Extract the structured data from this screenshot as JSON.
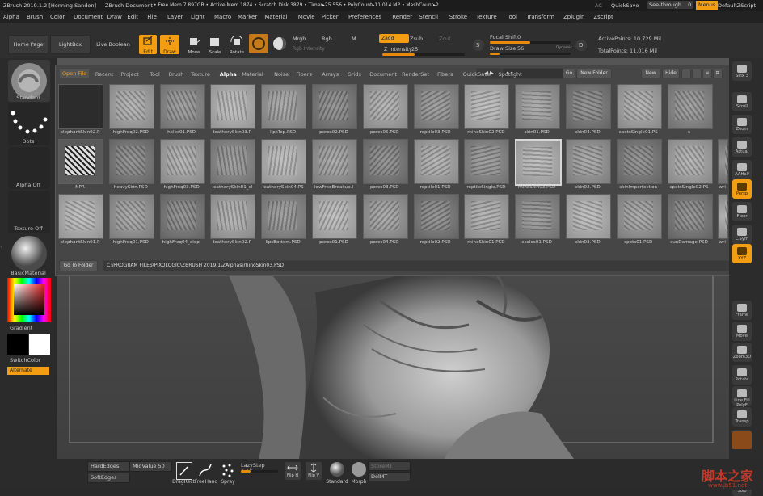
{
  "titlebar": {
    "app": "ZBrush 2019.1.2 [Henning Sanden]",
    "doc": "ZBrush Document",
    "stats": "• Free Mem 7.897GB • Active Mem 1874 • Scratch Disk 3879 • Timer▸25.556 • PolyCount▸11.014 MP • MeshCount▸2",
    "ac": "AC",
    "quicksave": "QuickSave",
    "seethrough": "See-through",
    "seethrough_value": "0",
    "menus": "Menus",
    "script": "DefaultZScript"
  },
  "menubar": [
    "Alpha",
    "Brush",
    "Color",
    "Document",
    "Draw",
    "Edit",
    "File",
    "Layer",
    "Light",
    "Macro",
    "Marker",
    "Material",
    "Movie",
    "Picker",
    "Preferences",
    "Render",
    "Stencil",
    "Stroke",
    "Texture",
    "Tool",
    "Transform",
    "Zplugin",
    "Zscript"
  ],
  "toolbar": {
    "home": "Home Page",
    "lightbox": "LightBox",
    "liveboolean": "Live Boolean",
    "edit": "Edit",
    "draw": "Draw",
    "move": "Move",
    "scale": "Scale",
    "rotate": "Rotate",
    "mrgb": "Mrgb",
    "rgb": "Rgb",
    "m": "M",
    "rgb_intensity": "Rgb Intensity",
    "zadd": "Zadd",
    "zsub": "Zsub",
    "zcut": "Zcut",
    "z_intensity": "Z Intensity",
    "z_intensity_value": "25",
    "focal_shift": "Focal Shift",
    "focal_shift_value": "0",
    "draw_size": "Draw Size",
    "draw_size_value": "56",
    "dynamic": "Dynamic",
    "active_points": "ActivePoints: 10.729 Mil",
    "total_points": "TotalPoints: 11.016 Mil"
  },
  "leftshelf": {
    "standard": "Standard",
    "dots": "Dots",
    "alpha_off": "Alpha Off",
    "texture_off": "Texture Off",
    "basic_material": "BasicMaterial",
    "gradient": "Gradient",
    "switch_color": "SwitchColor",
    "alternate": "Alternate"
  },
  "popup": {
    "tabs": [
      "Open File",
      "Recent",
      "Project",
      "Tool",
      "Brush",
      "Texture",
      "Alpha",
      "Material",
      "Noise",
      "Fibers",
      "Arrays",
      "Grids",
      "Document",
      "RenderSet",
      "Fibers",
      "QuickSave",
      "Spotlight"
    ],
    "active_tab": "Alpha",
    "go": "Go",
    "new_folder": "New Folder",
    "new": "New",
    "hide": "Hide",
    "go_to_folder": "Go To Folder",
    "path": "C:\\PROGRAM FILES\\PIXOLOGIC\\ZBRUSH 2019.1\\ZAlphas\\rhinoSkin03.PSD",
    "rows": [
      [
        "elephantSkin02.P",
        "highFreq02.PSD",
        "holes01.PSD",
        "leatherySkin03.P",
        "lipsTop.PSD",
        "pores02.PSD",
        "pores05.PSD",
        "reptile03.PSD",
        "rhinoSkin02.PSD",
        "skin01.PSD",
        "skin04.PSD",
        "spotsSingle01.PS",
        "s"
      ],
      [
        "NPR",
        "heavySkin.PSD",
        "highFreq03.PSD",
        "leatherySkin01_cl",
        "leatherySkin04.PS",
        "lowFreqBreakup.I",
        "pores03.PSD",
        "reptile01.PSD",
        "reptileSingle.PSD",
        "rhinoSkin03.PSD",
        "skin02.PSD",
        "skinImperfection",
        "spotsSingle02.PS",
        "wri"
      ],
      [
        "elephantSkin01.P",
        "highFreq01.PSD",
        "highFreq04_elepl",
        "leatherySkin02.P",
        "lipsBottom.PSD",
        "pores01.PSD",
        "pores04.PSD",
        "reptile02.PSD",
        "rhinoSkin01.PSD",
        "scales01.PSD",
        "skin03.PSD",
        "spots01.PSD",
        "sunDamage.PSD",
        "wri"
      ]
    ]
  },
  "rightshelf": [
    "SPix 3",
    "Scroll",
    "Zoom",
    "Actual",
    "AAHalf",
    "Persp",
    "Floor",
    "L.Sym",
    "XYZ",
    "Frame",
    "Move",
    "Zoom3D",
    "Rotate",
    "Line Fill PolyF",
    "Transp",
    "Ghost",
    "Solo"
  ],
  "bottombar": {
    "hardedges": "HardEdges",
    "midvalue": "MidValue",
    "midvalue_value": "50",
    "softedges": "SoftEdges",
    "lazystep": "LazyStep",
    "lazystep_value": "0.25",
    "draghex": "DragRect",
    "freehand": "FreeHand",
    "spray": "Spray",
    "flipH": "Flip H",
    "flipV": "Flip V",
    "standard": "Standard",
    "morph": "Morph",
    "storemt": "StoreMT",
    "delmt": "DelMT"
  },
  "watermark": {
    "text": "脚本之家",
    "url": "www.jb51.net"
  },
  "colors": {
    "accent": "#f29d12",
    "bg": "#2a2a2a",
    "panel": "#464646"
  }
}
